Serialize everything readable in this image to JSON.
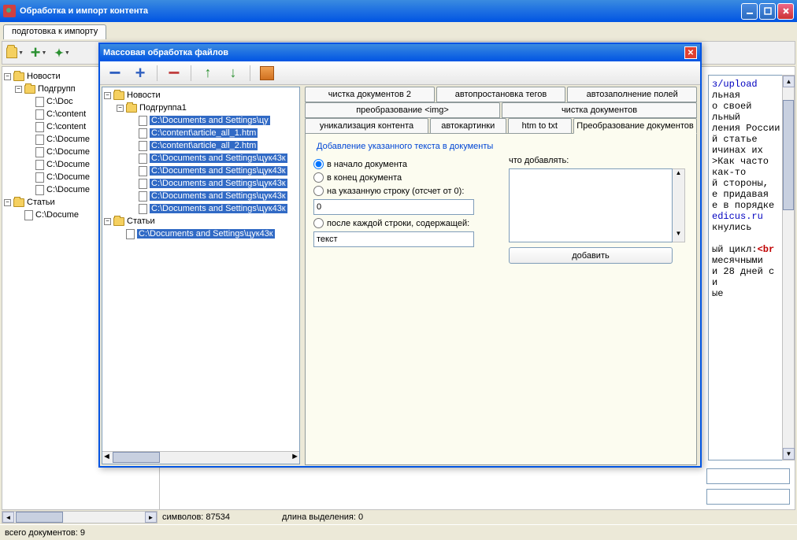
{
  "window": {
    "title": "Обработка и импорт контента"
  },
  "main_tab": "подготовка к импорту",
  "left_tree": {
    "root1": "Новости",
    "root1_sub": "Подгрупп",
    "files": [
      "C:\\Doc",
      "C:\\content",
      "C:\\content",
      "C:\\Docume",
      "C:\\Docume",
      "C:\\Docume",
      "C:\\Docume",
      "C:\\Docume"
    ],
    "root2": "Статьи",
    "root2_files": [
      "C:\\Docume"
    ]
  },
  "status": {
    "chars": "символов: 87534",
    "selection": "длина выделения: 0",
    "docs": "всего документов: 9"
  },
  "dialog": {
    "title": "Массовая обработка файлов",
    "tree": {
      "root1": "Новости",
      "sub1": "Подгруппа1",
      "files1": [
        "C:\\Documents and Settings\\цу",
        "C:\\content\\article_all_1.htm",
        "C:\\content\\article_all_2.htm",
        "C:\\Documents and Settings\\цук43к",
        "C:\\Documents and Settings\\цук43к",
        "C:\\Documents and Settings\\цук43к",
        "C:\\Documents and Settings\\цук43к",
        "C:\\Documents and Settings\\цук43к"
      ],
      "root2": "Статьи",
      "files2": [
        "C:\\Documents and Settings\\цук43к"
      ]
    },
    "tabs_row1": [
      "чистка документов 2",
      "автопростановка тегов",
      "автозаполнение полей"
    ],
    "tabs_row2": [
      "преобразование <img>",
      "чистка документов"
    ],
    "tabs_row3": [
      "уникализация контента",
      "автокартинки",
      "htm to txt",
      "Преобразование документов"
    ],
    "group_title": "Добавление указанного текста в документы",
    "radio1": "в начало документа",
    "radio2": "в конец документа",
    "radio3": "на указанную строку (отсчет от 0):",
    "radio4": "после каждой строки, содержащей:",
    "line_value": "0",
    "text_value": "текст",
    "what_label": "что добавлять:",
    "add_button": "добавить"
  },
  "code_snip": {
    "l1": "з/upload",
    "l2": "льная",
    "l3": "о своей",
    "l4": "льный",
    "l5": "ления России",
    "l6": "й статье",
    "l7": "ичинах их",
    "l8": ">Как часто",
    "l9": "как-то",
    "l10": "й стороны,",
    "l11": "е придавая",
    "l12": "е в порядке",
    "l13": "edicus.ru",
    "l14": "кнулись",
    "l15": "",
    "l16": "ый цикл:",
    "l16b": "<br",
    "l17": "месячными",
    "l18": "и 28 дней с",
    "l19": "и",
    "l20": "ые"
  }
}
